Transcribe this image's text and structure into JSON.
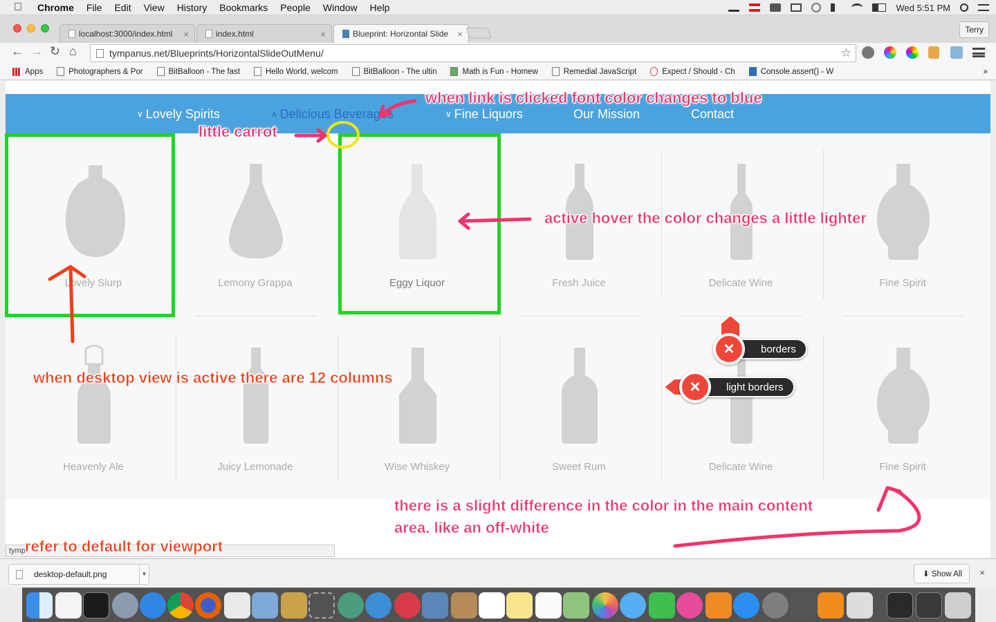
{
  "menubar": {
    "app": "Chrome",
    "items": [
      "File",
      "Edit",
      "View",
      "History",
      "Bookmarks",
      "People",
      "Window",
      "Help"
    ],
    "clock": "Wed 5:51 PM",
    "user": "Terry"
  },
  "tabs": [
    {
      "title": "localhost:3000/index.html",
      "active": false
    },
    {
      "title": "index.html",
      "active": false
    },
    {
      "title": "Blueprint: Horizontal Slide",
      "active": true
    }
  ],
  "address": {
    "url": "tympanus.net/Blueprints/HorizontalSlideOutMenu/"
  },
  "bookmarks": [
    {
      "label": "Apps"
    },
    {
      "label": "Photographers & Por"
    },
    {
      "label": "BitBalloon - The fast"
    },
    {
      "label": "Hello World, welcom"
    },
    {
      "label": "BitBalloon - The ultin"
    },
    {
      "label": "Math is Fun - Homew"
    },
    {
      "label": "Remedial JavaScript"
    },
    {
      "label": "Expect / Should - Ch"
    },
    {
      "label": "Console.assert() - W"
    }
  ],
  "bookmarks_more": "»",
  "site_nav": {
    "items": [
      {
        "label": "Lovely Spirits",
        "chevron": "∨",
        "active": false
      },
      {
        "label": "Delicious Beverages",
        "chevron": "∧",
        "active": true
      },
      {
        "label": "Fine Liquors",
        "chevron": "∨",
        "active": false
      },
      {
        "label": "Our Mission",
        "chevron": "",
        "active": false
      },
      {
        "label": "Contact",
        "chevron": "",
        "active": false
      }
    ]
  },
  "products": [
    {
      "name": "Lovely Slurp",
      "bottle": "round-bottle"
    },
    {
      "name": "Lemony Grappa",
      "bottle": "teardrop-bottle"
    },
    {
      "name": "Eggy Liquor",
      "bottle": "slim-bottle"
    },
    {
      "name": "Fresh Juice",
      "bottle": "tall-bottle"
    },
    {
      "name": "Delicate Wine",
      "bottle": "wine-bottle"
    },
    {
      "name": "Fine Spirit",
      "bottle": "decanter-bottle"
    },
    {
      "name": "Heavenly Ale",
      "bottle": "swingtop-bottle"
    },
    {
      "name": "Juicy Lemonade",
      "bottle": "tall-bottle"
    },
    {
      "name": "Wise Whiskey",
      "bottle": "whiskey-bottle"
    },
    {
      "name": "Sweet Rum",
      "bottle": "rum-bottle"
    },
    {
      "name": "Delicate Wine",
      "bottle": "wine-bottle"
    },
    {
      "name": "Fine Spirit",
      "bottle": "decanter-bottle"
    }
  ],
  "annotations": {
    "link_clicked": "when link is clicked font color changes to blue",
    "carrot": "little carrot",
    "hover": "active hover the color changes a little lighter",
    "columns": "when desktop view is active there are 12 columns",
    "offwhite_1": "there is a slight difference in the color in the main content",
    "offwhite_2": "area. like an off-white",
    "viewport": "refer to default for viewport"
  },
  "badges": {
    "borders": "borders",
    "light_borders": "light borders"
  },
  "status_text": "tymp",
  "downloads": {
    "file": "desktop-default.png",
    "show_all": "Show All"
  },
  "colors": {
    "nav_bg": "#4aa3df",
    "nav_active": "#2a6cc0",
    "annot_pink": "#f0346b",
    "annot_red": "#f0401a",
    "highlight_green": "#22d422",
    "highlight_yellow": "#f5e50f",
    "bottle": "#d2d2d2",
    "content_bg": "#f8f8f8"
  }
}
